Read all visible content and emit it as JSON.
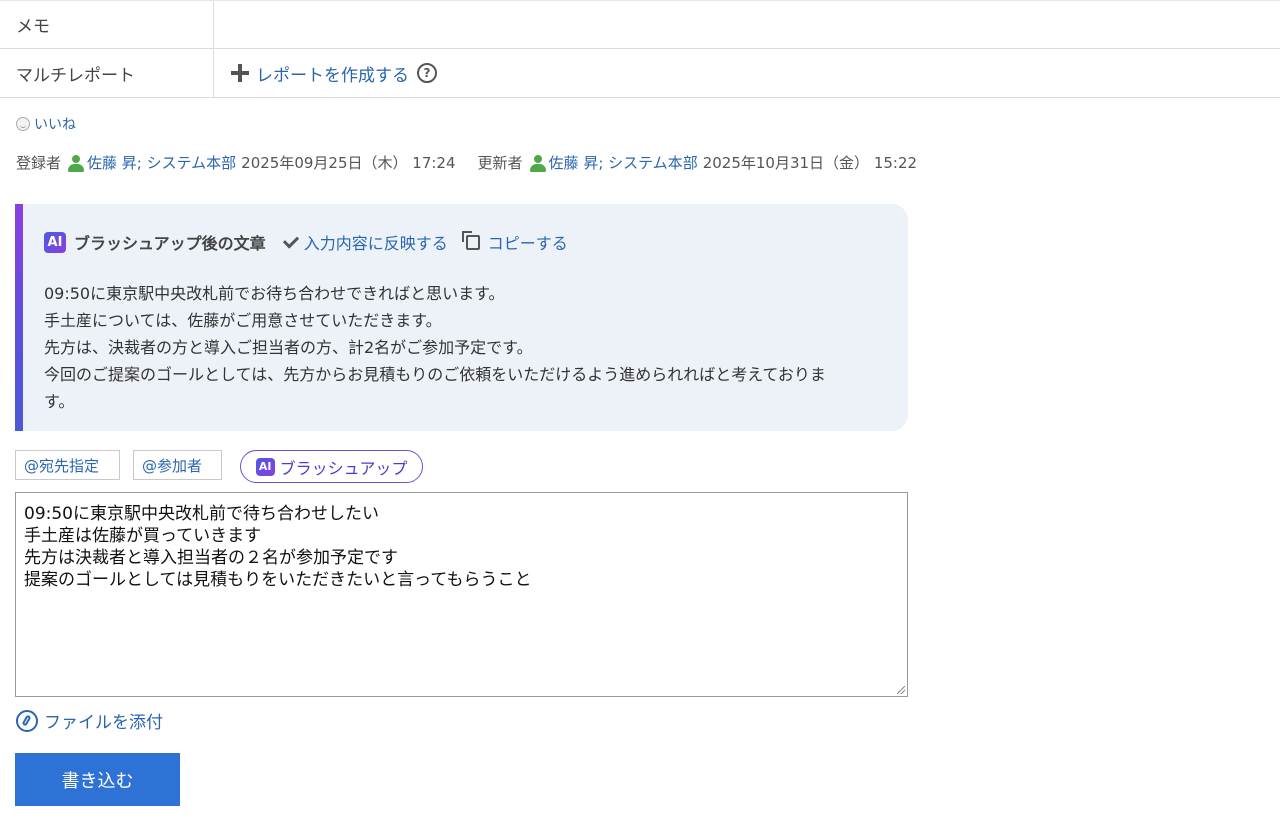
{
  "props": {
    "memo_label": "メモ",
    "memo_value": "",
    "multireport_label": "マルチレポート",
    "create_report_link": "レポートを作成する",
    "help_glyph": "?"
  },
  "like": {
    "label": "いいね"
  },
  "meta": {
    "registrant_label": "登録者",
    "registrant_name": "佐藤 昇; システム本部",
    "registered_at": "2025年09月25日（木） 17:24",
    "updater_label": "更新者",
    "updater_name": "佐藤 昇; システム本部",
    "updated_at": "2025年10月31日（金） 15:22"
  },
  "ai_panel": {
    "badge": "AI",
    "title": "ブラッシュアップ後の文章",
    "apply_link": "入力内容に反映する",
    "copy_link": "コピーする",
    "lines": [
      "09:50に東京駅中央改札前でお待ち合わせできればと思います。",
      "手土産については、佐藤がご用意させていただきます。",
      "先方は、決裁者の方と導入ご担当者の方、計2名がご参加予定です。",
      "今回のご提案のゴールとしては、先方からお見積もりのご依頼をいただけるよう進められればと考えておりま",
      "す。"
    ]
  },
  "toolbar": {
    "mention_addressee": "@宛先指定",
    "mention_participants": "@参加者",
    "brushup_badge": "AI",
    "brushup_label": "ブラッシュアップ"
  },
  "editor": {
    "lines": [
      "09:50に東京駅中央改札前で待ち合わせしたい",
      "手土産は佐藤が買っていきます",
      "先方は決裁者と導入担当者の２名が参加予定です",
      "提案のゴールとしては見積もりをいただきたいと言ってもらうこと"
    ]
  },
  "attach": {
    "label": "ファイルを添付"
  },
  "submit": {
    "label": "書き込む"
  },
  "colors": {
    "link": "#2a66b0",
    "primary_button": "#2f72d6",
    "ai_panel_bg": "#edf2f9",
    "user_icon": "#4fa94a"
  }
}
